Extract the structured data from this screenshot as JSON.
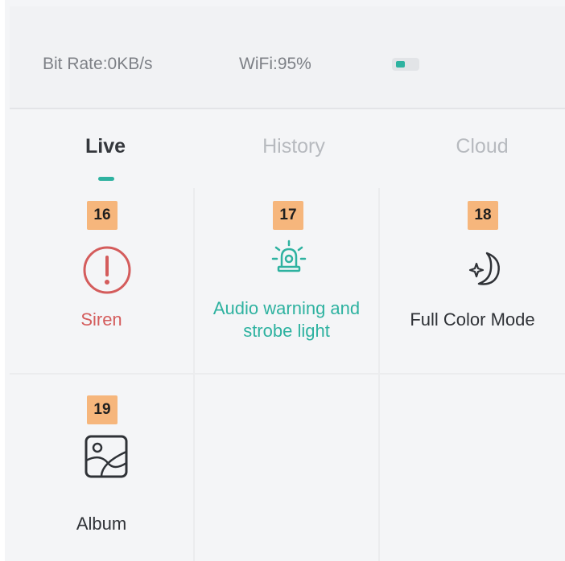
{
  "status": {
    "bit_rate": "Bit Rate:0KB/s",
    "wifi": "WiFi:95%",
    "battery_level": 0.45,
    "battery_icon": "battery-icon"
  },
  "tabs": {
    "live": "Live",
    "history": "History",
    "cloud": "Cloud",
    "active": "Live"
  },
  "features": [
    {
      "badge": "16",
      "label": "Siren",
      "icon": "siren-alert-icon",
      "color": "#d45c5c"
    },
    {
      "badge": "17",
      "label_line1": "Audio warning and",
      "label_line2": "strobe light",
      "icon": "strobe-light-icon",
      "color": "#2eb2a0"
    },
    {
      "badge": "18",
      "label": "Full Color Mode",
      "icon": "moon-star-icon",
      "color": "#2f3237"
    },
    {
      "badge": "19",
      "label": "Album",
      "icon": "album-image-icon",
      "color": "#2f3237"
    }
  ],
  "colors": {
    "accent": "#2eb2a0",
    "alert": "#d45c5c",
    "badge": "#f6b67c"
  }
}
